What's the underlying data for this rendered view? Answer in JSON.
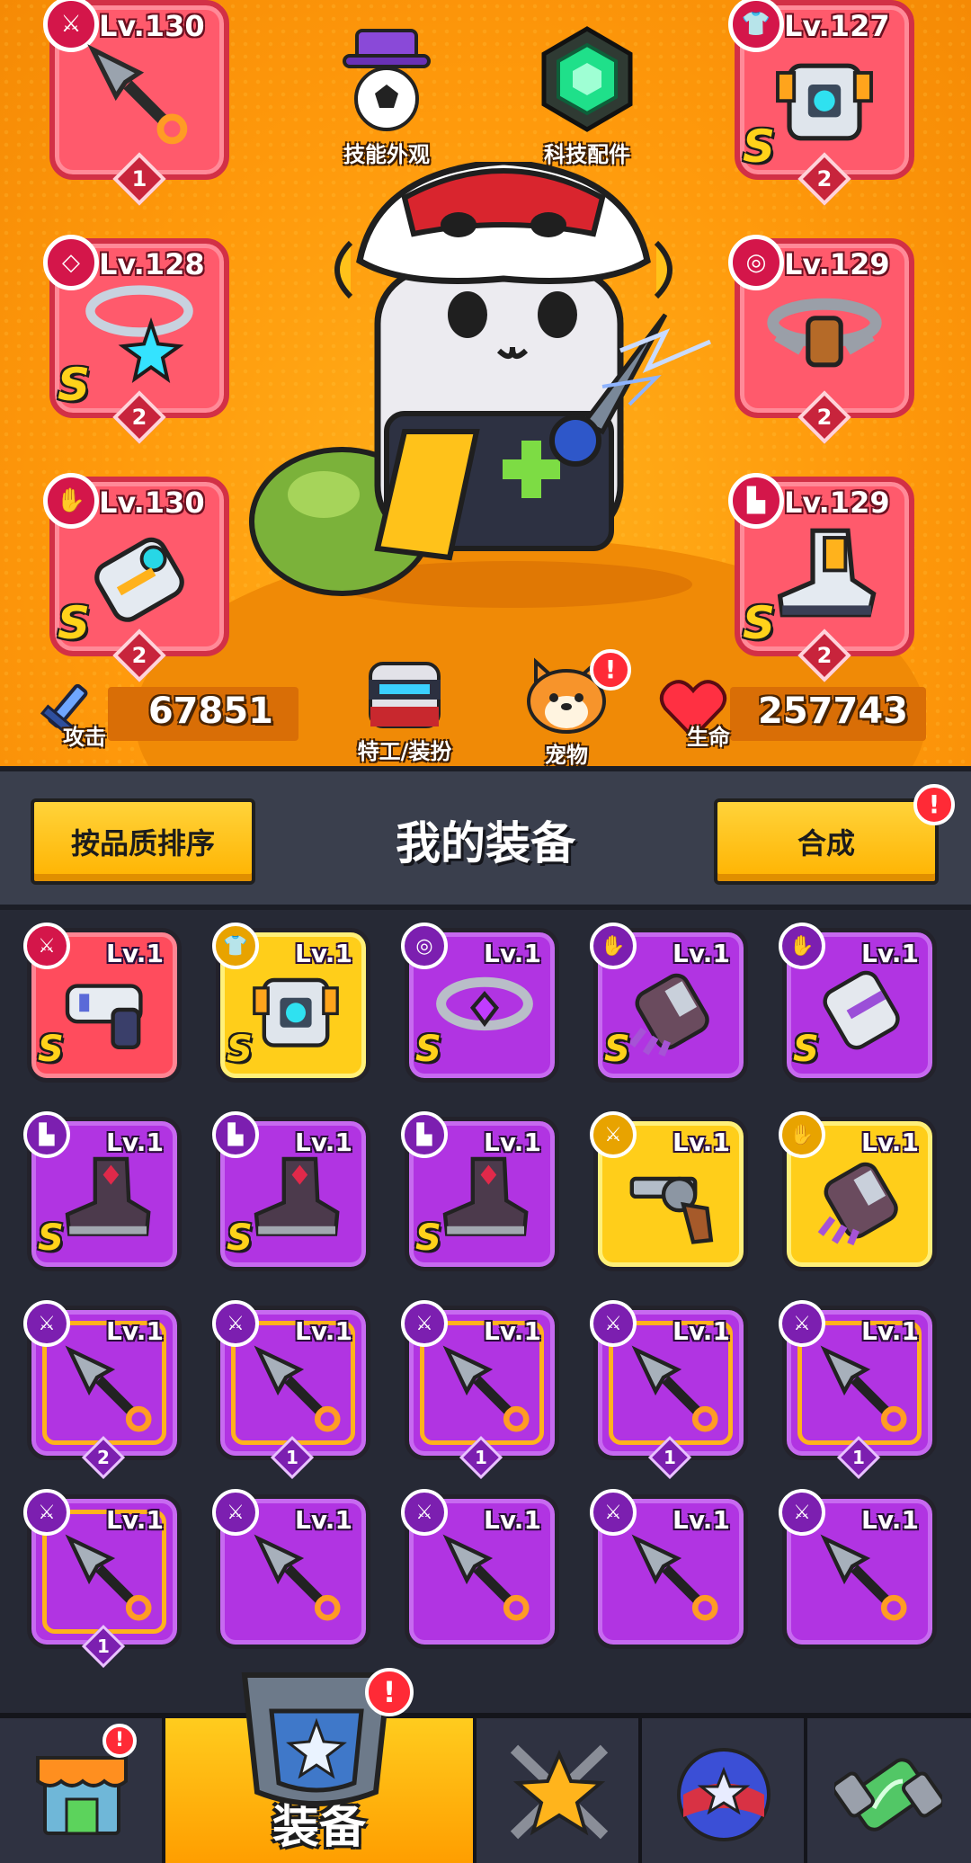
{
  "hero": {
    "menus": {
      "skill_skin": "技能外观",
      "tech_parts": "科技配件",
      "agent_outfit": "特工/装扮",
      "pet": "宠物"
    },
    "stats": {
      "attack_label": "攻击",
      "attack_value": "67851",
      "hp_label": "生命",
      "hp_value": "257743"
    },
    "equipped": [
      {
        "slot": "weapon",
        "level": "Lv.130",
        "grade": "",
        "count": "1",
        "icon": "kunai-icon"
      },
      {
        "slot": "necklace",
        "level": "Lv.128",
        "grade": "S",
        "count": "2",
        "icon": "star-necklace-icon"
      },
      {
        "slot": "gloves",
        "level": "Lv.130",
        "grade": "S",
        "count": "2",
        "icon": "mech-gauntlet-icon"
      },
      {
        "slot": "armor",
        "level": "Lv.127",
        "grade": "S",
        "count": "2",
        "icon": "mech-armor-icon"
      },
      {
        "slot": "belt",
        "level": "Lv.129",
        "grade": "",
        "count": "2",
        "icon": "belt-icon"
      },
      {
        "slot": "boots",
        "level": "Lv.129",
        "grade": "S",
        "count": "2",
        "icon": "mech-boots-icon"
      }
    ],
    "alert": "!"
  },
  "inventory": {
    "sort_button": "按品质排序",
    "title": "我的装备",
    "merge_button": "合成",
    "merge_alert": "!",
    "items": [
      {
        "level": "Lv.1",
        "rarity": "red",
        "grade": "S",
        "count": "",
        "icon": "laser-gun-icon",
        "type_icon": "weapon"
      },
      {
        "level": "Lv.1",
        "rarity": "yellow",
        "grade": "S",
        "count": "",
        "icon": "mech-armor-icon",
        "type_icon": "armor"
      },
      {
        "level": "Lv.1",
        "rarity": "purple",
        "grade": "S",
        "count": "",
        "icon": "gem-belt-icon",
        "type_icon": "belt"
      },
      {
        "level": "Lv.1",
        "rarity": "purple",
        "grade": "S",
        "count": "",
        "icon": "claw-gauntlet-icon",
        "type_icon": "gloves"
      },
      {
        "level": "Lv.1",
        "rarity": "purple",
        "grade": "S",
        "count": "",
        "icon": "silver-gauntlet-icon",
        "type_icon": "gloves"
      },
      {
        "level": "Lv.1",
        "rarity": "purple",
        "grade": "S",
        "count": "",
        "icon": "dark-boots-icon",
        "type_icon": "boots"
      },
      {
        "level": "Lv.1",
        "rarity": "purple",
        "grade": "S",
        "count": "",
        "icon": "dark-boots-icon",
        "type_icon": "boots"
      },
      {
        "level": "Lv.1",
        "rarity": "purple",
        "grade": "S",
        "count": "",
        "icon": "dark-boots-icon",
        "type_icon": "boots"
      },
      {
        "level": "Lv.1",
        "rarity": "yellow",
        "grade": "",
        "count": "",
        "icon": "revolver-icon",
        "type_icon": "weapon"
      },
      {
        "level": "Lv.1",
        "rarity": "yellow",
        "grade": "",
        "count": "",
        "icon": "claw-gauntlet-icon",
        "type_icon": "gloves"
      },
      {
        "level": "Lv.1",
        "rarity": "purple",
        "grade": "",
        "count": "2",
        "icon": "kunai-icon",
        "type_icon": "weapon",
        "framed": true
      },
      {
        "level": "Lv.1",
        "rarity": "purple",
        "grade": "",
        "count": "1",
        "icon": "kunai-icon",
        "type_icon": "weapon",
        "framed": true
      },
      {
        "level": "Lv.1",
        "rarity": "purple",
        "grade": "",
        "count": "1",
        "icon": "kunai-icon",
        "type_icon": "weapon",
        "framed": true
      },
      {
        "level": "Lv.1",
        "rarity": "purple",
        "grade": "",
        "count": "1",
        "icon": "kunai-icon",
        "type_icon": "weapon",
        "framed": true
      },
      {
        "level": "Lv.1",
        "rarity": "purple",
        "grade": "",
        "count": "1",
        "icon": "kunai-icon",
        "type_icon": "weapon",
        "framed": true
      },
      {
        "level": "Lv.1",
        "rarity": "purple",
        "grade": "",
        "count": "1",
        "icon": "kunai-icon",
        "type_icon": "weapon",
        "framed": true
      },
      {
        "level": "Lv.1",
        "rarity": "purple",
        "grade": "",
        "count": "",
        "icon": "kunai-icon",
        "type_icon": "weapon"
      },
      {
        "level": "Lv.1",
        "rarity": "purple",
        "grade": "",
        "count": "",
        "icon": "kunai-icon",
        "type_icon": "weapon"
      },
      {
        "level": "Lv.1",
        "rarity": "purple",
        "grade": "",
        "count": "",
        "icon": "kunai-icon",
        "type_icon": "weapon"
      },
      {
        "level": "Lv.1",
        "rarity": "purple",
        "grade": "",
        "count": "",
        "icon": "kunai-icon",
        "type_icon": "weapon"
      }
    ]
  },
  "nav": {
    "tabs": [
      {
        "name": "shop",
        "icon": "shop-icon",
        "label": "",
        "alert": "!"
      },
      {
        "name": "equipment",
        "icon": "equipment-icon",
        "label": "装备",
        "alert": "!",
        "active": true
      },
      {
        "name": "talent",
        "icon": "star-swords-icon",
        "label": ""
      },
      {
        "name": "challenge",
        "icon": "star-ball-icon",
        "label": ""
      },
      {
        "name": "evolve",
        "icon": "dna-capsule-icon",
        "label": ""
      }
    ]
  },
  "colors": {
    "hero_bg": "#ff9a0c",
    "red_rarity": "#ff4c5d",
    "purple_rarity": "#b134e2",
    "yellow_rarity": "#ffce1a",
    "button_yellow": "#ffc400"
  }
}
